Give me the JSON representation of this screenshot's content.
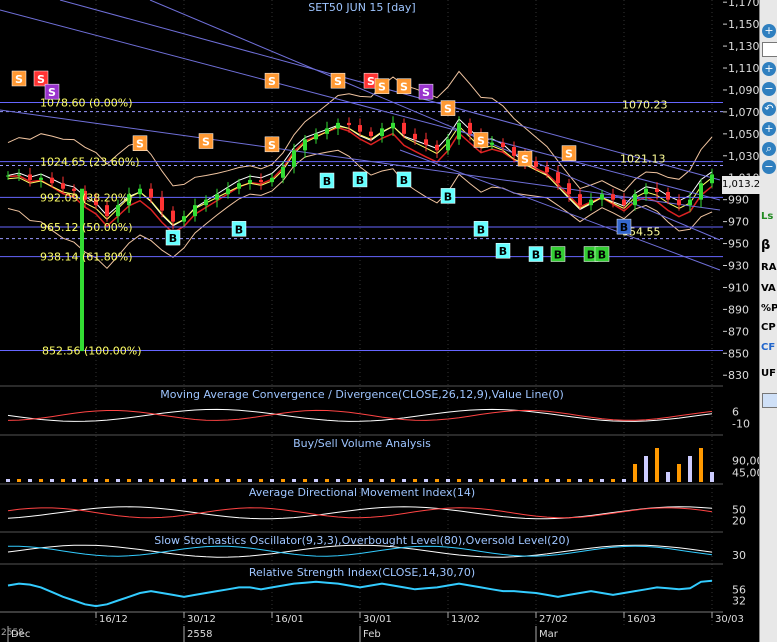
{
  "title": "SET50 JUN 15   [day]",
  "last_price": "1,013.2",
  "chart_data": [
    {
      "type": "candlestick",
      "title": "SET50 JUN 15   [day]",
      "y_ticks": [
        "1,170",
        "1,150",
        "1,130",
        "1,110",
        "1,090",
        "1,070",
        "1,050",
        "1,030",
        "1,010",
        "990",
        "970",
        "950",
        "930",
        "910",
        "890",
        "870",
        "850",
        "830"
      ],
      "ylim": [
        822,
        1172
      ],
      "x_ticks": [
        "16/12",
        "30/12",
        "16/01",
        "30/01",
        "13/02",
        "27/02",
        "16/03",
        "30/03"
      ],
      "x_tick_days": [
        8,
        16,
        24,
        32,
        40,
        48,
        56,
        64
      ],
      "secondary_x_labels": [
        "Dec",
        "2558",
        "Feb",
        "Mar"
      ],
      "secondary_x_days": [
        0,
        16,
        32,
        48
      ],
      "close": [
        1012,
        1013,
        1008,
        1010,
        1005,
        1000,
        998,
        990,
        985,
        975,
        985,
        995,
        1000,
        992,
        980,
        970,
        975,
        985,
        990,
        995,
        1000,
        1005,
        1008,
        1006,
        1010,
        1020,
        1035,
        1045,
        1050,
        1055,
        1060,
        1058,
        1052,
        1048,
        1055,
        1060,
        1050,
        1045,
        1040,
        1035,
        1045,
        1060,
        1050,
        1040,
        1042,
        1038,
        1030,
        1025,
        1020,
        1015,
        1005,
        995,
        985,
        990,
        995,
        990,
        985,
        995,
        1000,
        997,
        990,
        985,
        990,
        1005,
        1013
      ],
      "fibonacci": [
        {
          "label": "1078.60 (0.00%)",
          "value": 1078.6
        },
        {
          "label": "1024.65 (23.60%)",
          "value": 1024.65
        },
        {
          "label": "992.09 (38.20%)",
          "value": 992.09
        },
        {
          "label": "965.12 (50.00%)",
          "value": 965.12
        },
        {
          "label": "938.14 (61.80%)",
          "value": 938.14
        },
        {
          "label": "852.56 (100.00%)",
          "value": 852.56
        }
      ],
      "levels": [
        {
          "label": "1070.23",
          "value": 1070.23
        },
        {
          "label": "1021.13",
          "value": 1021.13
        },
        {
          "label": "954.55",
          "value": 954.55
        }
      ],
      "signals": [
        {
          "text": "S",
          "day": 1,
          "price": 1100,
          "color": "#ff9933"
        },
        {
          "text": "S",
          "day": 3,
          "price": 1100,
          "color": "#ff3333"
        },
        {
          "text": "S",
          "day": 4,
          "price": 1088,
          "color": "#9933cc"
        },
        {
          "text": "S",
          "day": 12,
          "price": 1041,
          "color": "#ff9933"
        },
        {
          "text": "S",
          "day": 18,
          "price": 1043,
          "color": "#ff9933"
        },
        {
          "text": "S",
          "day": 24,
          "price": 1040,
          "color": "#ff9933"
        },
        {
          "text": "S",
          "day": 24,
          "price": 1098,
          "color": "#ff9933"
        },
        {
          "text": "S",
          "day": 30,
          "price": 1098,
          "color": "#ff9933"
        },
        {
          "text": "S",
          "day": 33,
          "price": 1098,
          "color": "#ff3333"
        },
        {
          "text": "S",
          "day": 34,
          "price": 1093,
          "color": "#ff9933"
        },
        {
          "text": "S",
          "day": 36,
          "price": 1093,
          "color": "#ff9933"
        },
        {
          "text": "S",
          "day": 38,
          "price": 1088,
          "color": "#9933cc"
        },
        {
          "text": "S",
          "day": 40,
          "price": 1073,
          "color": "#ff9933"
        },
        {
          "text": "S",
          "day": 43,
          "price": 1044,
          "color": "#ff9933"
        },
        {
          "text": "S",
          "day": 47,
          "price": 1027,
          "color": "#ff9933"
        },
        {
          "text": "S",
          "day": 51,
          "price": 1032,
          "color": "#ff9933"
        },
        {
          "text": "B",
          "day": 15,
          "price": 955,
          "color": "#66ffff"
        },
        {
          "text": "B",
          "day": 21,
          "price": 963,
          "color": "#66ffff"
        },
        {
          "text": "B",
          "day": 29,
          "price": 1007,
          "color": "#66ffff"
        },
        {
          "text": "B",
          "day": 32,
          "price": 1008,
          "color": "#66ffff"
        },
        {
          "text": "B",
          "day": 36,
          "price": 1008,
          "color": "#66ffff"
        },
        {
          "text": "B",
          "day": 40,
          "price": 993,
          "color": "#66ffff"
        },
        {
          "text": "B",
          "day": 43,
          "price": 963,
          "color": "#66ffff"
        },
        {
          "text": "B",
          "day": 45,
          "price": 943,
          "color": "#66ffff"
        },
        {
          "text": "B",
          "day": 48,
          "price": 940,
          "color": "#66ffff"
        },
        {
          "text": "B",
          "day": 50,
          "price": 940,
          "color": "#33cc33"
        },
        {
          "text": "B",
          "day": 53,
          "price": 940,
          "color": "#33cc33"
        },
        {
          "text": "B",
          "day": 54,
          "price": 940,
          "color": "#33cc33"
        },
        {
          "text": "B",
          "day": 56,
          "price": 965,
          "color": "#3366cc"
        }
      ]
    },
    {
      "type": "line",
      "title": "Moving Average Convergence / Divergence(CLOSE,26,12,9),Value Line(0)",
      "y_ticks": [
        "6",
        "-10"
      ]
    },
    {
      "type": "bar",
      "title": "Buy/Sell Volume Analysis",
      "y_ticks": [
        "90,00",
        "45,00"
      ]
    },
    {
      "type": "line",
      "title": "Average Directional Movement Index(14)",
      "y_ticks": [
        "50",
        "20"
      ]
    },
    {
      "type": "line",
      "title": "Slow Stochastics Oscillator(9,3,3),Overbought Level(80),Oversold Level(20)",
      "y_ticks": [
        "30"
      ]
    },
    {
      "type": "line",
      "title": "Relative Strength Index(CLOSE,14,30,70)",
      "y_ticks": [
        "56",
        "32"
      ],
      "series": [
        {
          "values": [
            52,
            54,
            53,
            50,
            45,
            40,
            36,
            32,
            30,
            32,
            36,
            40,
            44,
            46,
            44,
            42,
            40,
            42,
            44,
            46,
            48,
            50,
            50,
            48,
            50,
            52,
            54,
            55,
            56,
            55,
            54,
            52,
            50,
            52,
            54,
            52,
            50,
            48,
            49,
            50,
            52,
            54,
            52,
            50,
            48,
            46,
            46,
            45,
            44,
            42,
            40,
            42,
            44,
            46,
            44,
            42,
            44,
            46,
            48,
            50,
            49,
            48,
            49,
            56,
            57
          ]
        }
      ]
    }
  ],
  "toolbar": {
    "labels": [
      "Ls",
      "β",
      "RA",
      "VA",
      "%P",
      "CP",
      "CF",
      "UF"
    ],
    "last_label": "UF"
  },
  "corner_label": "2558"
}
